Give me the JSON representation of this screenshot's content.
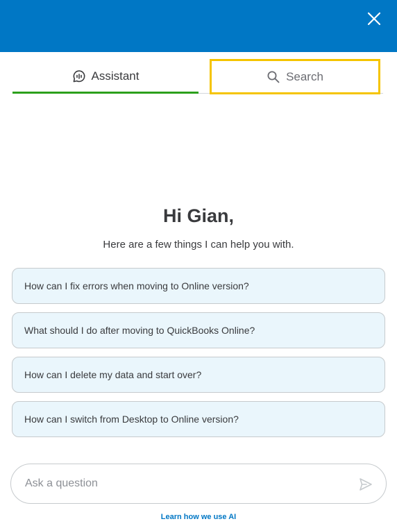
{
  "header": {
    "close_icon": "close-icon",
    "bar_color": "#0077c5"
  },
  "tabs": [
    {
      "label": "Assistant",
      "icon": "chat-bubble-icon",
      "active": true,
      "accent": "#2ca01c"
    },
    {
      "label": "Search",
      "icon": "search-icon",
      "active": false,
      "highlight": "#f5c400"
    }
  ],
  "greeting": {
    "title": "Hi Gian,",
    "subtitle": "Here are a few things I can help you with."
  },
  "suggestions": [
    "How can I fix errors when moving to Online version?",
    "What should I do after moving to QuickBooks Online?",
    "How can I delete my data and start over?",
    "How can I switch from Desktop to Online version?"
  ],
  "composer": {
    "placeholder": "Ask a question",
    "value": "",
    "send_icon": "send-icon"
  },
  "footer": {
    "link_label": "Learn how we use AI",
    "link_color": "#0077c5"
  }
}
